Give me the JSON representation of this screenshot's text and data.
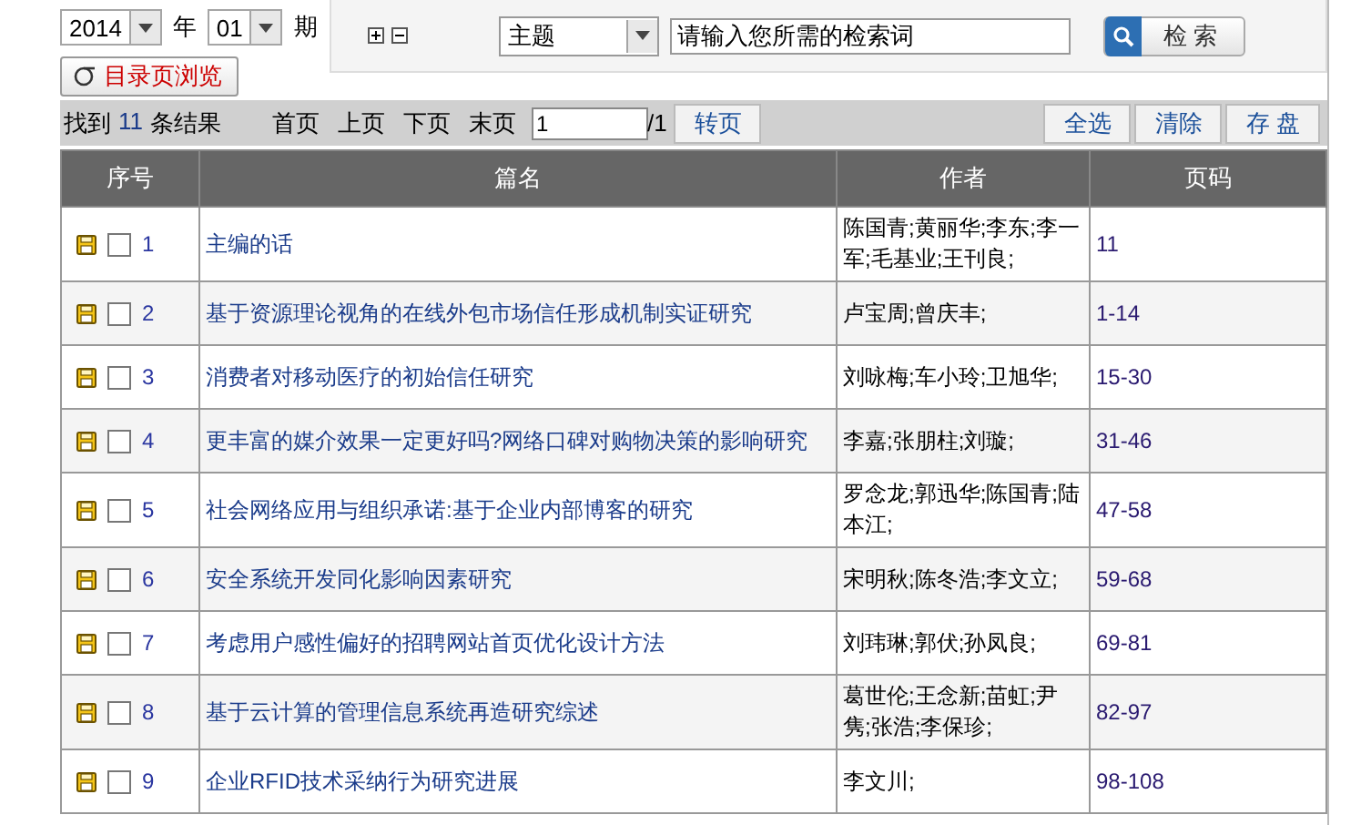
{
  "issue_selector": {
    "year": "2014",
    "year_label": "年",
    "issue": "01",
    "issue_label": "期",
    "browse_button": "目录页浏览"
  },
  "search": {
    "field": "主题",
    "placeholder": "请输入您所需的检索词",
    "button": "检 索"
  },
  "toolbar": {
    "found_prefix": "找到",
    "count": "11",
    "found_suffix": "条结果",
    "pager": [
      "首页",
      "上页",
      "下页",
      "末页"
    ],
    "page_value": "1",
    "page_total": "/1",
    "go_button": "转页",
    "actions": [
      "全选",
      "清除",
      "存 盘"
    ]
  },
  "table": {
    "columns": [
      "序号",
      "篇名",
      "作者",
      "页码"
    ],
    "rows": [
      {
        "number": "1",
        "title": "主编的话",
        "authors": "陈国青;黄丽华;李东;李一军;毛基业;王刊良;",
        "pages": "11",
        "checked": false
      },
      {
        "number": "2",
        "title": "基于资源理论视角的在线外包市场信任形成机制实证研究",
        "authors": "卢宝周;曾庆丰;",
        "pages": "1-14",
        "checked": false
      },
      {
        "number": "3",
        "title": "消费者对移动医疗的初始信任研究",
        "authors": "刘咏梅;车小玲;卫旭华;",
        "pages": "15-30",
        "checked": false
      },
      {
        "number": "4",
        "title": "更丰富的媒介效果一定更好吗?网络口碑对购物决策的影响研究",
        "authors": "李嘉;张朋柱;刘璇;",
        "pages": "31-46",
        "checked": false
      },
      {
        "number": "5",
        "title": "社会网络应用与组织承诺:基于企业内部博客的研究",
        "authors": "罗念龙;郭迅华;陈国青;陆本江;",
        "pages": "47-58",
        "checked": false
      },
      {
        "number": "6",
        "title": "安全系统开发同化影响因素研究",
        "authors": "宋明秋;陈冬浩;李文立;",
        "pages": "59-68",
        "checked": false
      },
      {
        "number": "7",
        "title": "考虑用户感性偏好的招聘网站首页优化设计方法",
        "authors": "刘玮琳;郭伏;孙凤良;",
        "pages": "69-81",
        "checked": false
      },
      {
        "number": "8",
        "title": "基于云计算的管理信息系统再造研究综述",
        "authors": "葛世伦;王念新;苗虹;尹隽;张浩;李保珍;",
        "pages": "82-97",
        "checked": false
      },
      {
        "number": "9",
        "title": "企业RFID技术采纳行为研究进展",
        "authors": "李文川;",
        "pages": "98-108",
        "checked": false
      }
    ]
  }
}
